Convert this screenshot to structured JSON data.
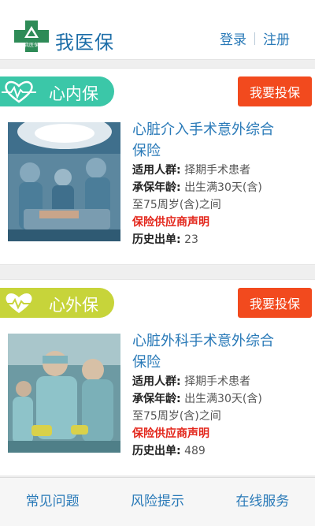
{
  "header": {
    "app_title": "我医保",
    "login_label": "登录",
    "register_label": "注册",
    "logo_text": "我医保",
    "brand_color": "#1d6ea8"
  },
  "products": [
    {
      "category_label": "心内保",
      "category_icon": "heart-pulse-icon",
      "category_color": "#3bc7a8",
      "buy_label": "我要投保",
      "title_line1": "心脏介入手术意外综合",
      "title_line2": "保险",
      "audience_key": "适用人群:",
      "audience_value": "择期手术患者",
      "age_key": "承保年龄:",
      "age_value_line1": "出生满30天(含)",
      "age_value_line2": "至75周岁(含)之间",
      "notice": "保险供应商声明",
      "sold_key": "历史出单:",
      "sold_value": "23"
    },
    {
      "category_label": "心外保",
      "category_icon": "heart-pulse-icon",
      "category_color": "#c7d43a",
      "buy_label": "我要投保",
      "title_line1": "心脏外科手术意外综合",
      "title_line2": "保险",
      "audience_key": "适用人群:",
      "audience_value": "择期手术患者",
      "age_key": "承保年龄:",
      "age_value_line1": "出生满30天(含)",
      "age_value_line2": "至75周岁(含)之间",
      "notice": "保险供应商声明",
      "sold_key": "历史出单:",
      "sold_value": "489"
    }
  ],
  "bottom_nav": {
    "faq": "常见问题",
    "risk": "风险提示",
    "service": "在线服务"
  },
  "colors": {
    "buy_button": "#f24a1e",
    "notice": "#e3261b",
    "link": "#2a7ab8"
  }
}
